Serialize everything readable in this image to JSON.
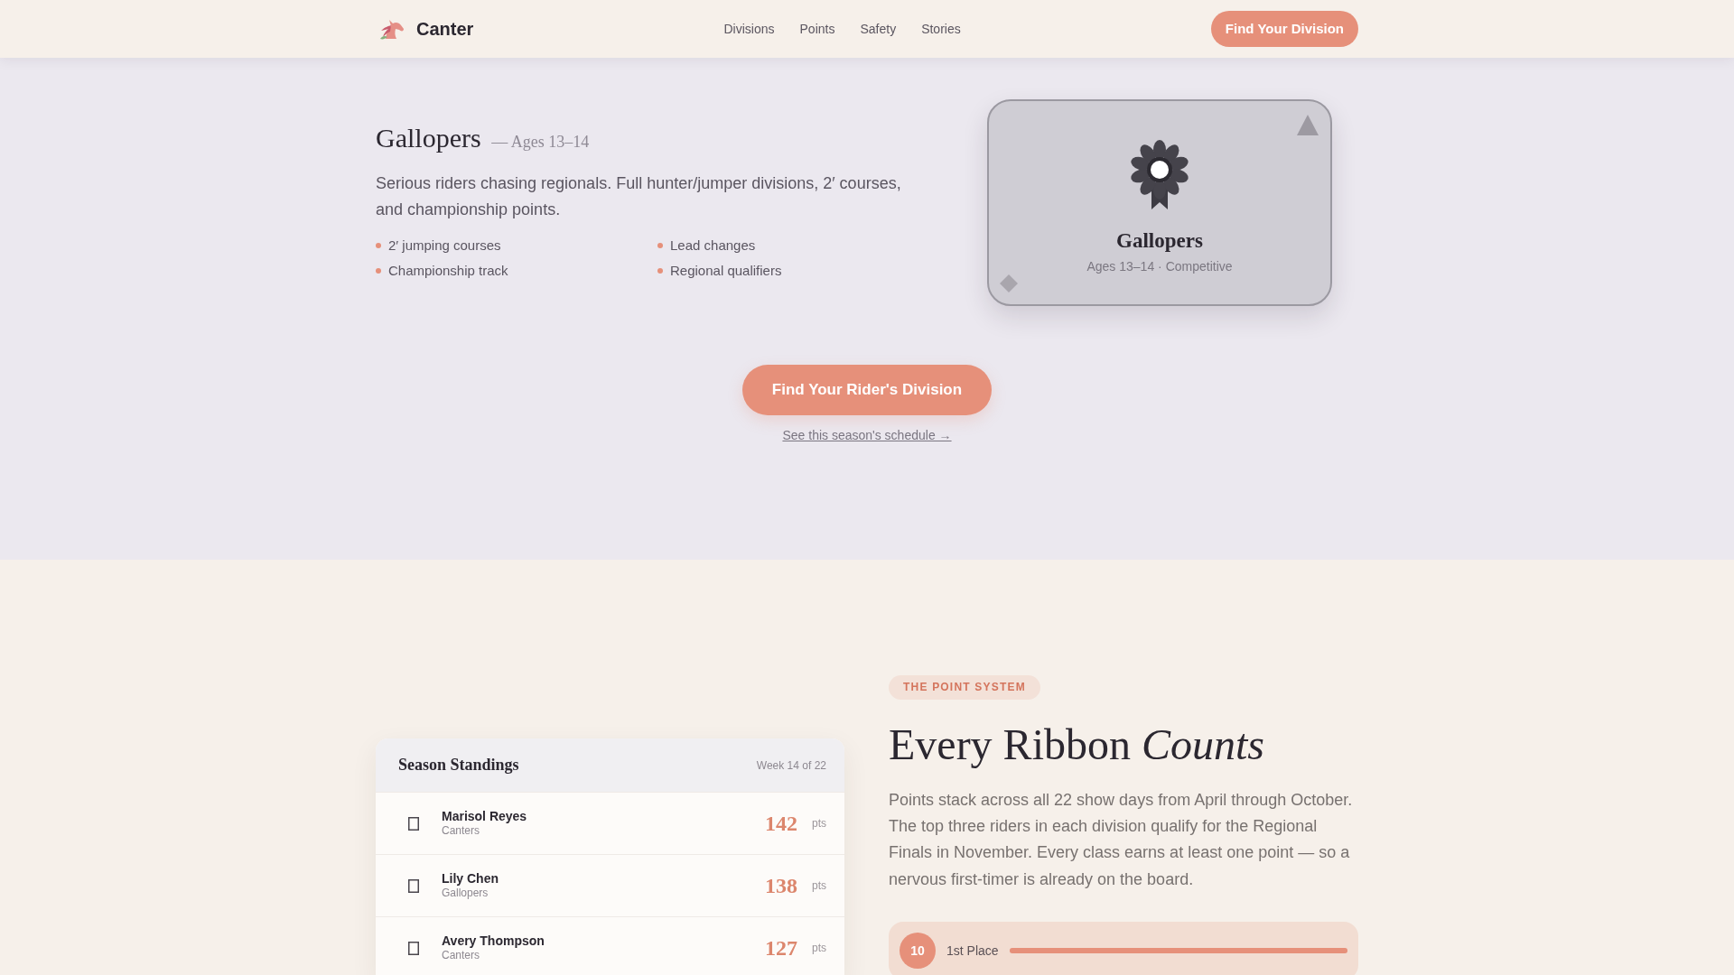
{
  "navbar": {
    "brand": "Canter",
    "links": [
      {
        "label": "Divisions"
      },
      {
        "label": "Points"
      },
      {
        "label": "Safety"
      },
      {
        "label": "Stories"
      }
    ],
    "cta": "Find Your Division"
  },
  "division": {
    "title": "Gallopers",
    "ages": "— Ages 13–14",
    "description": "Serious riders chasing regionals. Full hunter/jumper divisions, 2′ courses, and championship points.",
    "features": [
      "2′ jumping courses",
      "Lead changes",
      "Championship track",
      "Regional qualifiers"
    ],
    "card": {
      "title": "Gallopers",
      "meta": "Ages 13–14 · Competitive"
    }
  },
  "cta": {
    "button": "Find Your Rider's Division",
    "link": "See this season's schedule →"
  },
  "standings": {
    "title": "Season Standings",
    "week": "Week 14 of 22",
    "rows": [
      {
        "name": "Marisol Reyes",
        "division": "Canters",
        "points": "142",
        "unit": "pts"
      },
      {
        "name": "Lily Chen",
        "division": "Gallopers",
        "points": "138",
        "unit": "pts"
      },
      {
        "name": "Avery Thompson",
        "division": "Canters",
        "points": "127",
        "unit": "pts"
      }
    ]
  },
  "point_system": {
    "badge": "THE POINT SYSTEM",
    "heading": "Every Ribbon *Counts*",
    "description": "Points stack across all 22 show days from April through October. The top three riders in each division qualify for the Regional Finals in November. Every class earns at least one point — so a nervous first-timer is already on the board.",
    "places": [
      {
        "points": "10",
        "label": "1st Place",
        "level": 1
      }
    ]
  }
}
